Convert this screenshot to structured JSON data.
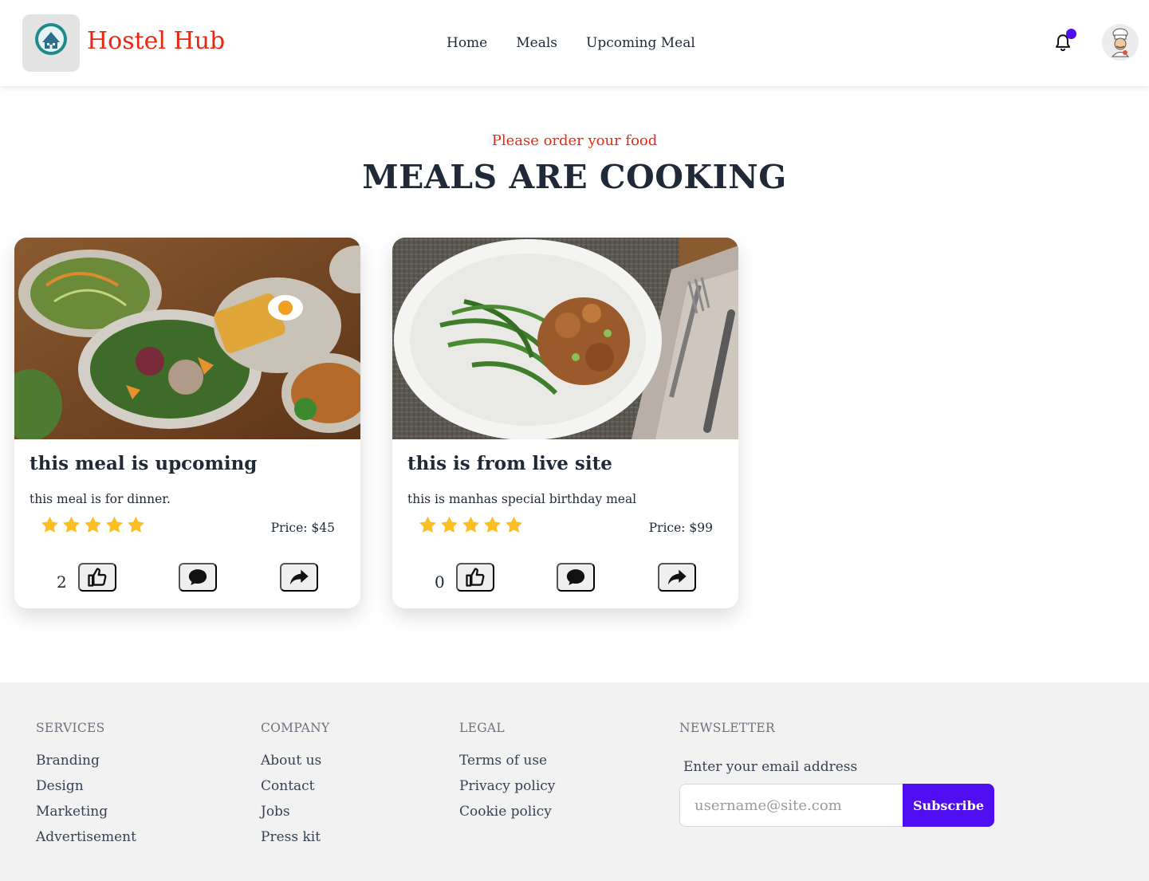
{
  "nav": {
    "brand": "Hostel Hub",
    "logo_text": "HOSTELHUB",
    "links": [
      "Home",
      "Meals",
      "Upcoming Meal"
    ],
    "icons": {
      "bell": "bell-icon",
      "notification_dot_color": "#4f0df2",
      "avatar": "chef-avatar"
    }
  },
  "hero": {
    "kicker": "Please order your food",
    "title": "MEALS ARE COOKING"
  },
  "meals": [
    {
      "title": "this meal is upcoming",
      "description": "this meal is for dinner.",
      "rating": 5,
      "price": "Price: $45",
      "likes": "2",
      "image": "salad-waffle-egg-spread"
    },
    {
      "title": "this is from live site",
      "description": "this is manhas special birthday meal",
      "rating": 5,
      "price": "Price: $99",
      "likes": "0",
      "image": "green-beans-chicken-plate"
    }
  ],
  "footer": {
    "services": {
      "heading": "SERVICES",
      "links": [
        "Branding",
        "Design",
        "Marketing",
        "Advertisement"
      ]
    },
    "company": {
      "heading": "COMPANY",
      "links": [
        "About us",
        "Contact",
        "Jobs",
        "Press kit"
      ]
    },
    "legal": {
      "heading": "LEGAL",
      "links": [
        "Terms of use",
        "Privacy policy",
        "Cookie policy"
      ]
    },
    "newsletter": {
      "heading": "NEWSLETTER",
      "label": "Enter your email address",
      "placeholder": "username@site.com",
      "button": "Subscribe"
    }
  },
  "colors": {
    "accent": "#e8280f",
    "brand_primary": "#4f0df2",
    "star": "#fbbf24"
  }
}
